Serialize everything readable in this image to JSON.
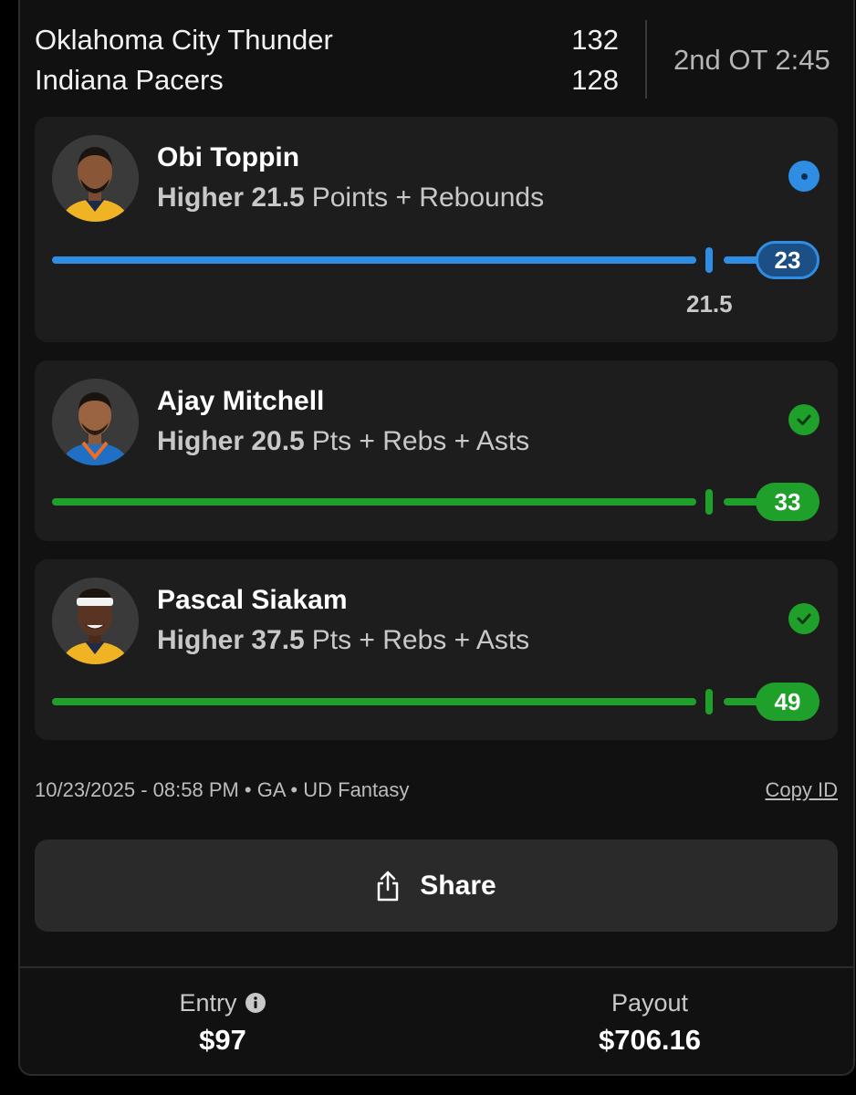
{
  "scoreboard": {
    "team1": {
      "name": "Oklahoma City Thunder",
      "score": "132"
    },
    "team2": {
      "name": "Indiana Pacers",
      "score": "128"
    },
    "clock": "2nd OT 2:45"
  },
  "picks": [
    {
      "player": "Obi Toppin",
      "direction": "Higher 21.5",
      "stat": "Points + Rebounds",
      "line_label": "21.5",
      "current": "23",
      "status": "live",
      "status_icon": "live-dot-icon",
      "progress": 1.0,
      "color": "#2f8de4",
      "jersey_color": "#f0b323"
    },
    {
      "player": "Ajay Mitchell",
      "direction": "Higher 20.5",
      "stat": "Pts + Rebs + Asts",
      "current": "33",
      "status": "hit",
      "status_icon": "check-circle-icon",
      "progress": 1.0,
      "color": "#1fa02a",
      "jersey_color": "#1f6fc4"
    },
    {
      "player": "Pascal Siakam",
      "direction": "Higher 37.5",
      "stat": "Pts + Rebs + Asts",
      "current": "49",
      "status": "hit",
      "status_icon": "check-circle-icon",
      "progress": 1.0,
      "color": "#1fa02a",
      "jersey_color": "#f0b323"
    }
  ],
  "meta": {
    "entry_info": "10/23/2025 - 08:58 PM • GA • UD Fantasy",
    "copy_id": "Copy ID"
  },
  "share": {
    "label": "Share",
    "icon": "share-icon"
  },
  "footer": {
    "entry_label": "Entry",
    "entry_value": "$97",
    "payout_label": "Payout",
    "payout_value": "$706.16",
    "info_icon": "info-icon"
  }
}
